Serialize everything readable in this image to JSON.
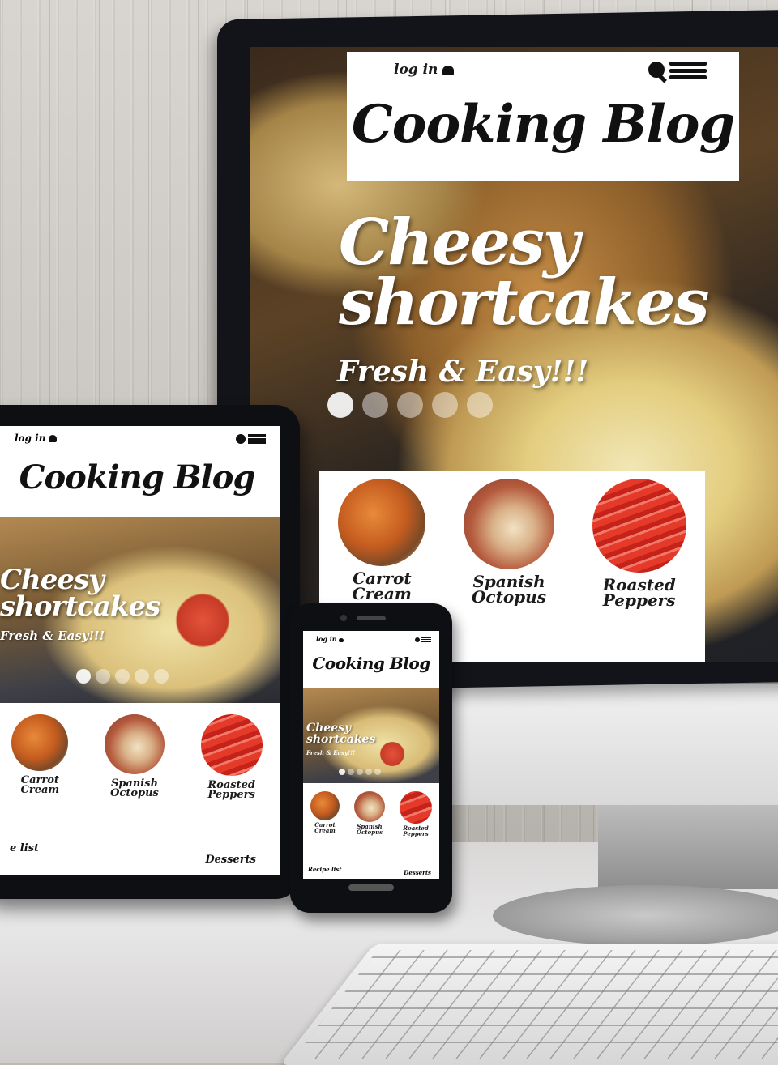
{
  "blog": {
    "login_label": "log in",
    "title": "Cooking Blog",
    "hero": {
      "title_line1": "Cheesy",
      "title_line2": "shortcakes",
      "subtitle": "Fresh & Easy!!!"
    },
    "carousel": {
      "slide_count": 5,
      "active_index": 0
    },
    "recipes": [
      {
        "name_line1": "Carrot",
        "name_line2": "Cream",
        "image": "carrot-thumbnail"
      },
      {
        "name_line1": "Spanish",
        "name_line2": "Octopus",
        "image": "octopus-thumbnail"
      },
      {
        "name_line1": "Roasted",
        "name_line2": "Peppers",
        "image": "pepper-thumbnail"
      }
    ],
    "footer": {
      "left_link": "Recipe list",
      "tablet_left_link": "e list",
      "right_link": "Desserts"
    },
    "icons": {
      "login": "chef-hat-icon",
      "search": "search-icon",
      "menu": "hamburger-menu-icon"
    }
  },
  "colors": {
    "text_dark": "#111111",
    "header_bg": "#ffffff",
    "device_frame": "#0d0f13",
    "pepper_red": "#e53a2a",
    "carrot_orange": "#e88a3a"
  }
}
